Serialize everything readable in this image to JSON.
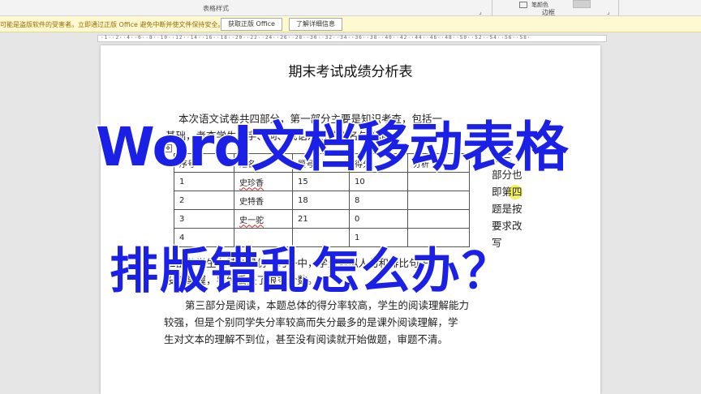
{
  "ribbon": {
    "table_styles_label": "表格样式",
    "mini_label": "笔颜色",
    "border_label": "边框"
  },
  "message_bar": {
    "text": "可能是盗版软件的受害者。立即通过正版 Office 避免中断并使文件保持安全。",
    "get_office_button": "获取正版 Office",
    "learn_more_button": "了解详细信息"
  },
  "ruler": {
    "marks": "·1··2··4··6··8··10··12··14··16··18··20··22··24··26··28··30··32··34··36··38··40··42··44··46··48··50··52··54··56··58·"
  },
  "document": {
    "title": "期末考试成绩分析表",
    "para1_line1": "本次语文试卷共四部分，第一部分主要是知识考查，包括一",
    "para1_line2": "基础，考查学生的字、词、成语及古诗文名句等情",
    "table": {
      "headers": [
        "序号",
        "姓名",
        "题号",
        "得分",
        "分析"
      ],
      "rows": [
        [
          "1",
          "史珍香",
          "15",
          "10",
          ""
        ],
        [
          "2",
          "史特香",
          "18",
          "8",
          ""
        ],
        [
          "3",
          "史一驼",
          "21",
          "0",
          ""
        ],
        [
          "4",
          "",
          "",
          "1",
          ""
        ]
      ]
    },
    "side_text": [
      "第三",
      "部分也",
      "即第四",
      "题是按",
      "要求改",
      "写"
    ],
    "para2_line1": "二部分学生在特别是仿写句子中，学生对拟人句和排比句子",
    "para2_line2": "没有掌握，导致丢失了很多分数。",
    "para3_line1": "第三部分是阅读，本题总体的得分率较高，学生的阅读理解能力",
    "para3_line2": "较强，但是个别同学失分率较高而失分最多的是课外阅读理解，学",
    "para3_line3": "生对文本的理解不到位，甚至没有阅读就开始做题，审题不清。"
  },
  "overlay": {
    "line1": "Word文档移动表格",
    "line2": "排版错乱怎么办？"
  },
  "colors": {
    "overlay_text": "#1a20e6",
    "message_bar_bg": "#fff9d1",
    "highlight": "#f4ef4a"
  }
}
